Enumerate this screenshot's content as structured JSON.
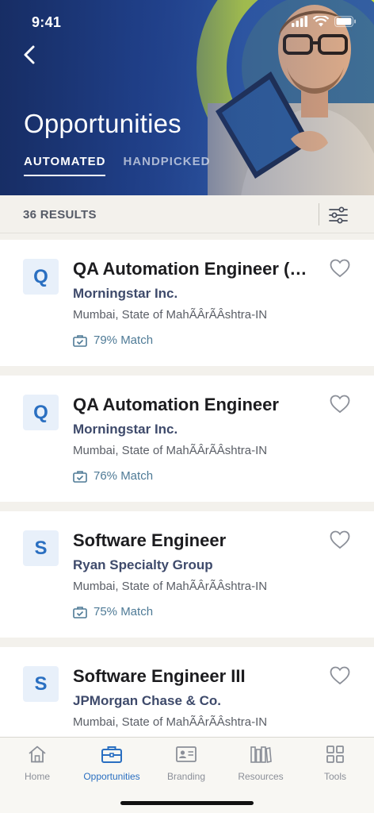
{
  "status_bar": {
    "time": "9:41"
  },
  "header": {
    "title": "Opportunities",
    "tabs": [
      {
        "label": "AUTOMATED",
        "active": true
      },
      {
        "label": "HANDPICKED",
        "active": false
      }
    ]
  },
  "results": {
    "count_label": "36 RESULTS"
  },
  "jobs": [
    {
      "logo_letter": "Q",
      "title": "QA Automation Engineer (M...",
      "company": "Morningstar Inc.",
      "location": "Mumbai, State of MahÃÂrÃÂshtra-IN",
      "match": "79% Match"
    },
    {
      "logo_letter": "Q",
      "title": "QA Automation Engineer",
      "company": "Morningstar Inc.",
      "location": "Mumbai, State of MahÃÂrÃÂshtra-IN",
      "match": "76% Match"
    },
    {
      "logo_letter": "S",
      "title": "Software Engineer",
      "company": "Ryan Specialty Group",
      "location": "Mumbai, State of MahÃÂrÃÂshtra-IN",
      "match": "75% Match"
    },
    {
      "logo_letter": "S",
      "title": "Software Engineer III",
      "company": "JPMorgan Chase & Co.",
      "location": "Mumbai, State of MahÃÂrÃÂshtra-IN",
      "match": ""
    }
  ],
  "nav": [
    {
      "label": "Home",
      "icon": "home-icon",
      "active": false
    },
    {
      "label": "Opportunities",
      "icon": "briefcase-icon",
      "active": true
    },
    {
      "label": "Branding",
      "icon": "id-card-icon",
      "active": false
    },
    {
      "label": "Resources",
      "icon": "books-icon",
      "active": false
    },
    {
      "label": "Tools",
      "icon": "grid-icon",
      "active": false
    }
  ],
  "colors": {
    "accent": "#2a6fc1",
    "header_blue": "#24489a",
    "lime": "#c6e03a",
    "match_text": "#4e7a96"
  }
}
